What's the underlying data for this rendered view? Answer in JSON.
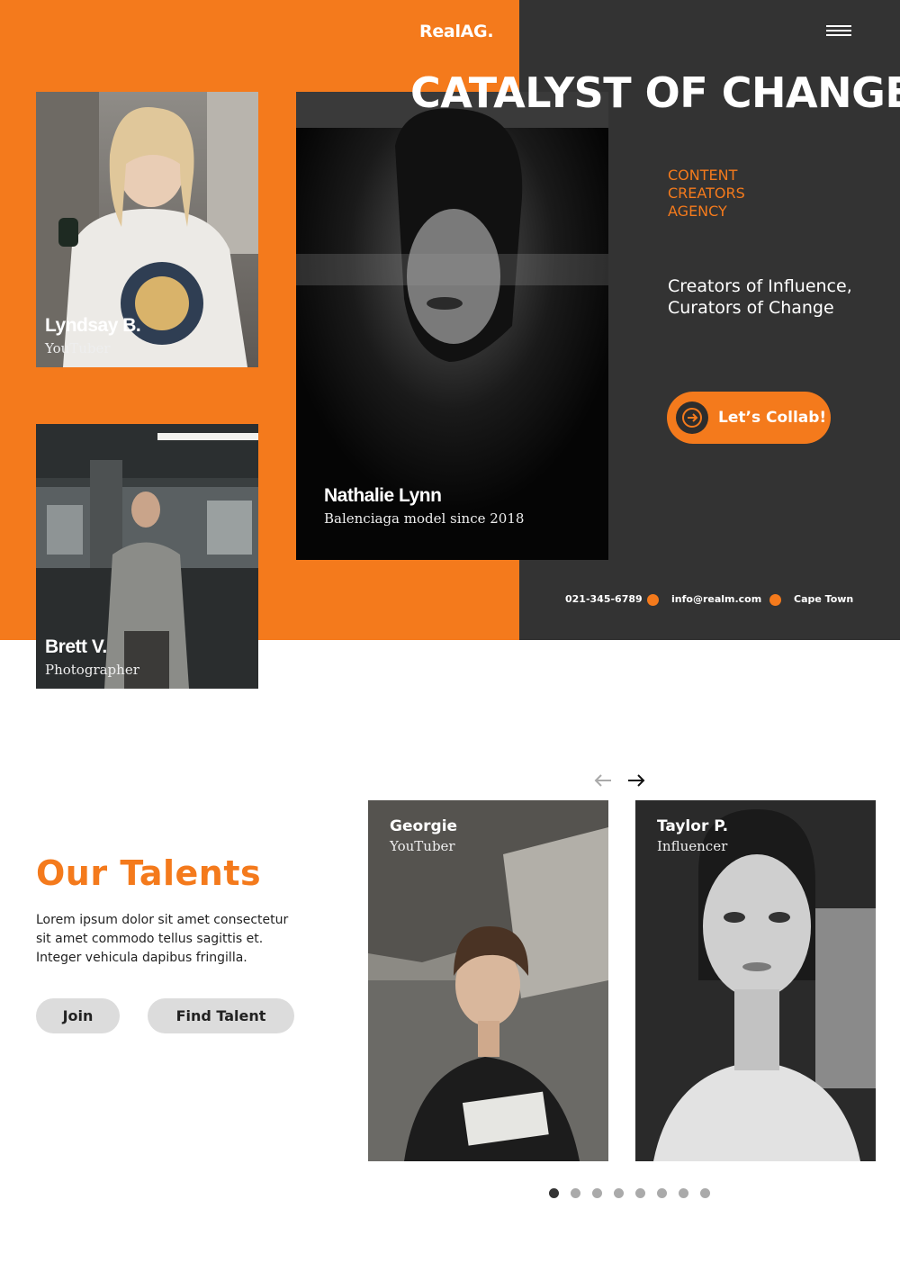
{
  "brand": {
    "logo": "RealAG."
  },
  "hero": {
    "headline": "CATALYST OF CHANGE",
    "tagline": [
      "CONTENT",
      "CREATORS",
      "AGENCY"
    ],
    "subline": "Creators of Influence, Curators of Change",
    "cta_label": "Let’s Collab!"
  },
  "featured_cards": [
    {
      "name": "Lyndsay B.",
      "role": "YouTuber"
    },
    {
      "name": "Brett V.",
      "role": "Photographer"
    },
    {
      "name": "Nathalie Lynn",
      "role": "Balenciaga model since 2018"
    }
  ],
  "contact": {
    "phone": "021-345-6789",
    "email": "info@realm.com",
    "city": "Cape Town"
  },
  "talents": {
    "title": "Our Talents",
    "description": "Lorem ipsum dolor sit amet consectetur sit amet commodo tellus sagittis et. Integer vehicula dapibus fringilla.",
    "join_label": "Join",
    "find_label": "Find Talent",
    "cards": [
      {
        "name": "Georgie",
        "role": "YouTuber"
      },
      {
        "name": "Taylor P.",
        "role": "Influencer"
      }
    ],
    "pagination": {
      "total": 8,
      "active": 1
    }
  },
  "colors": {
    "accent": "#f47a1c",
    "dark": "#333333"
  },
  "icons": {
    "menu": "hamburger-menu-icon",
    "cta": "arrow-right-icon",
    "prev": "arrow-left-icon",
    "next": "arrow-right-icon"
  }
}
